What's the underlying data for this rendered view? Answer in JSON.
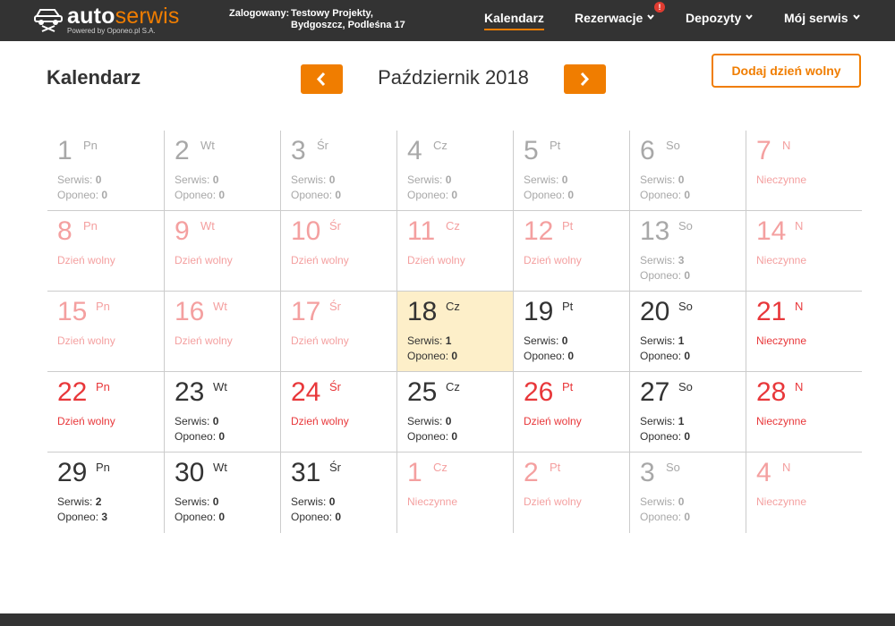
{
  "brand": {
    "word_part1": "auto",
    "word_part2": "serwis",
    "subtitle": "Powered by Oponeo.pl S.A.",
    "accent_color": "#f07d00"
  },
  "login": {
    "label": "Zalogowany:",
    "line1": "Testowy Projekty,",
    "line2": "Bydgoszcz, Podleśna 17"
  },
  "nav": {
    "calendar": "Kalendarz",
    "reservations": "Rezerwacje",
    "reservations_alert": "!",
    "deposits": "Depozyty",
    "my_service": "Mój serwis"
  },
  "header": {
    "title": "Kalendarz",
    "month": "Październik 2018",
    "prev_icon": "chevron-left-icon",
    "next_icon": "chevron-right-icon",
    "add_day_off": "Dodaj dzień wolny"
  },
  "labels": {
    "serwis": "Serwis:",
    "oponeo": "Oponeo:",
    "closed": "Nieczynne",
    "day_off": "Dzień wolny"
  },
  "weeks": [
    [
      {
        "num": "1",
        "abbr": "Pn",
        "style": "grey",
        "kind": "counts",
        "serwis": "0",
        "oponeo": "0"
      },
      {
        "num": "2",
        "abbr": "Wt",
        "style": "grey",
        "kind": "counts",
        "serwis": "0",
        "oponeo": "0"
      },
      {
        "num": "3",
        "abbr": "Śr",
        "style": "grey",
        "kind": "counts",
        "serwis": "0",
        "oponeo": "0"
      },
      {
        "num": "4",
        "abbr": "Cz",
        "style": "grey",
        "kind": "counts",
        "serwis": "0",
        "oponeo": "0"
      },
      {
        "num": "5",
        "abbr": "Pt",
        "style": "grey",
        "kind": "counts",
        "serwis": "0",
        "oponeo": "0"
      },
      {
        "num": "6",
        "abbr": "So",
        "style": "grey",
        "kind": "counts",
        "serwis": "0",
        "oponeo": "0"
      },
      {
        "num": "7",
        "abbr": "N",
        "style": "pink",
        "kind": "closed"
      }
    ],
    [
      {
        "num": "8",
        "abbr": "Pn",
        "style": "pink",
        "kind": "dayoff"
      },
      {
        "num": "9",
        "abbr": "Wt",
        "style": "pink",
        "kind": "dayoff"
      },
      {
        "num": "10",
        "abbr": "Śr",
        "style": "pink",
        "kind": "dayoff"
      },
      {
        "num": "11",
        "abbr": "Cz",
        "style": "pink",
        "kind": "dayoff"
      },
      {
        "num": "12",
        "abbr": "Pt",
        "style": "pink",
        "kind": "dayoff"
      },
      {
        "num": "13",
        "abbr": "So",
        "style": "grey",
        "kind": "counts",
        "serwis": "3",
        "oponeo": "0"
      },
      {
        "num": "14",
        "abbr": "N",
        "style": "pink",
        "kind": "closed"
      }
    ],
    [
      {
        "num": "15",
        "abbr": "Pn",
        "style": "pink",
        "kind": "dayoff"
      },
      {
        "num": "16",
        "abbr": "Wt",
        "style": "pink",
        "kind": "dayoff"
      },
      {
        "num": "17",
        "abbr": "Śr",
        "style": "pink",
        "kind": "dayoff"
      },
      {
        "num": "18",
        "abbr": "Cz",
        "style": "dark",
        "kind": "counts",
        "serwis": "1",
        "oponeo": "0",
        "today": true
      },
      {
        "num": "19",
        "abbr": "Pt",
        "style": "dark",
        "kind": "counts",
        "serwis": "0",
        "oponeo": "0"
      },
      {
        "num": "20",
        "abbr": "So",
        "style": "dark",
        "kind": "counts",
        "serwis": "1",
        "oponeo": "0"
      },
      {
        "num": "21",
        "abbr": "N",
        "style": "red",
        "kind": "closed"
      }
    ],
    [
      {
        "num": "22",
        "abbr": "Pn",
        "style": "red",
        "kind": "dayoff"
      },
      {
        "num": "23",
        "abbr": "Wt",
        "style": "dark",
        "kind": "counts",
        "serwis": "0",
        "oponeo": "0"
      },
      {
        "num": "24",
        "abbr": "Śr",
        "style": "red",
        "kind": "dayoff"
      },
      {
        "num": "25",
        "abbr": "Cz",
        "style": "dark",
        "kind": "counts",
        "serwis": "0",
        "oponeo": "0"
      },
      {
        "num": "26",
        "abbr": "Pt",
        "style": "red",
        "kind": "dayoff"
      },
      {
        "num": "27",
        "abbr": "So",
        "style": "dark",
        "kind": "counts",
        "serwis": "1",
        "oponeo": "0"
      },
      {
        "num": "28",
        "abbr": "N",
        "style": "red",
        "kind": "closed"
      }
    ],
    [
      {
        "num": "29",
        "abbr": "Pn",
        "style": "dark",
        "kind": "counts",
        "serwis": "2",
        "oponeo": "3"
      },
      {
        "num": "30",
        "abbr": "Wt",
        "style": "dark",
        "kind": "counts",
        "serwis": "0",
        "oponeo": "0"
      },
      {
        "num": "31",
        "abbr": "Śr",
        "style": "dark",
        "kind": "counts",
        "serwis": "0",
        "oponeo": "0"
      },
      {
        "num": "1",
        "abbr": "Cz",
        "style": "pink",
        "kind": "closed"
      },
      {
        "num": "2",
        "abbr": "Pt",
        "style": "pink",
        "kind": "dayoff"
      },
      {
        "num": "3",
        "abbr": "So",
        "style": "grey",
        "kind": "counts",
        "serwis": "0",
        "oponeo": "0"
      },
      {
        "num": "4",
        "abbr": "N",
        "style": "pink",
        "kind": "closed"
      }
    ]
  ]
}
